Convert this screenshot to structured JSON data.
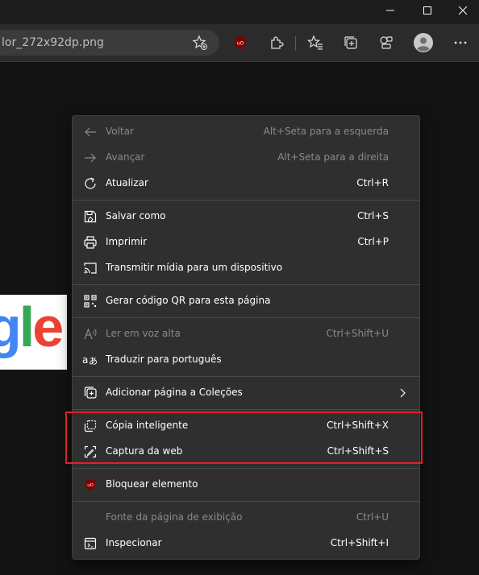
{
  "window": {
    "controls": {
      "minimize": "minimize-icon",
      "maximize": "maximize-icon",
      "close": "close-icon"
    }
  },
  "toolbar": {
    "address_text": "lor_272x92dp.png",
    "icons": [
      "add-favorite-icon",
      "ublock-icon",
      "extensions-icon",
      "favorites-icon",
      "collections-icon",
      "performance-icon",
      "profile-avatar",
      "more-icon"
    ]
  },
  "page": {
    "logo_letters": [
      "g",
      "l",
      "e"
    ]
  },
  "context_menu": {
    "back": {
      "label": "Voltar",
      "shortcut": "Alt+Seta para a esquerda"
    },
    "forward": {
      "label": "Avançar",
      "shortcut": "Alt+Seta para a direita"
    },
    "refresh": {
      "label": "Atualizar",
      "shortcut": "Ctrl+R"
    },
    "save_as": {
      "label": "Salvar como",
      "shortcut": "Ctrl+S"
    },
    "print": {
      "label": "Imprimir",
      "shortcut": "Ctrl+P"
    },
    "cast": {
      "label": "Transmitir mídia para um dispositivo",
      "shortcut": ""
    },
    "qr_code": {
      "label": "Gerar código QR para esta página",
      "shortcut": ""
    },
    "read_aloud": {
      "label": "Ler em voz alta",
      "shortcut": "Ctrl+Shift+U"
    },
    "translate": {
      "label": "Traduzir para português",
      "shortcut": ""
    },
    "add_to_collections": {
      "label": "Adicionar página a Coleções",
      "shortcut": ""
    },
    "smart_copy": {
      "label": "Cópia inteligente",
      "shortcut": "Ctrl+Shift+X"
    },
    "web_capture": {
      "label": "Captura da web",
      "shortcut": "Ctrl+Shift+S"
    },
    "block_element": {
      "label": "Bloquear elemento",
      "shortcut": ""
    },
    "view_source": {
      "label": "Fonte da página de exibição",
      "shortcut": "Ctrl+U"
    },
    "inspect": {
      "label": "Inspecionar",
      "shortcut": "Ctrl+Shift+I"
    }
  },
  "colors": {
    "menu_bg": "#2f2f2f",
    "highlight_border": "#e0202a",
    "ublock_red": "#800000"
  }
}
